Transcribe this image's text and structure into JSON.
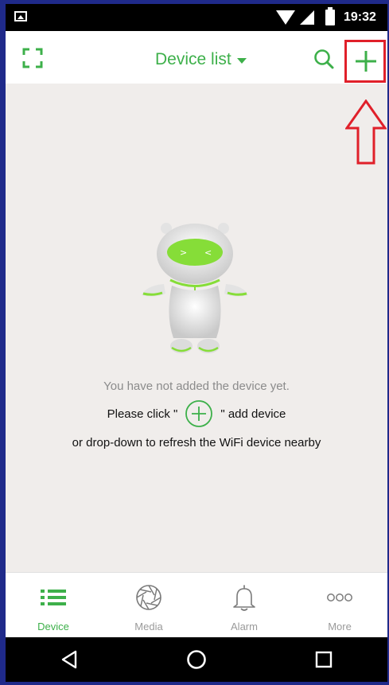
{
  "status_bar": {
    "time": "19:32",
    "icons": [
      "image-notification-icon",
      "wifi-icon",
      "signal-icon",
      "battery-icon"
    ]
  },
  "header": {
    "title": "Device list",
    "left_icon": "scan-icon",
    "right_icons": [
      "search-icon",
      "add-icon"
    ]
  },
  "empty_state": {
    "line1": "You have not added the device yet.",
    "line2_before": "Please click \"",
    "line2_after": "\" add device",
    "line3": "or drop-down to refresh the WiFi device nearby"
  },
  "tabs": [
    {
      "label": "Device",
      "icon": "list-icon",
      "active": true
    },
    {
      "label": "Media",
      "icon": "aperture-icon",
      "active": false
    },
    {
      "label": "Alarm",
      "icon": "bell-icon",
      "active": false
    },
    {
      "label": "More",
      "icon": "more-dots-icon",
      "active": false
    }
  ],
  "nav_buttons": [
    "back-icon",
    "home-icon",
    "recents-icon"
  ],
  "colors": {
    "accent": "#3db04a",
    "highlight_box": "#e0202a",
    "content_bg": "#f0edeb",
    "frame": "#1f2a8a"
  }
}
